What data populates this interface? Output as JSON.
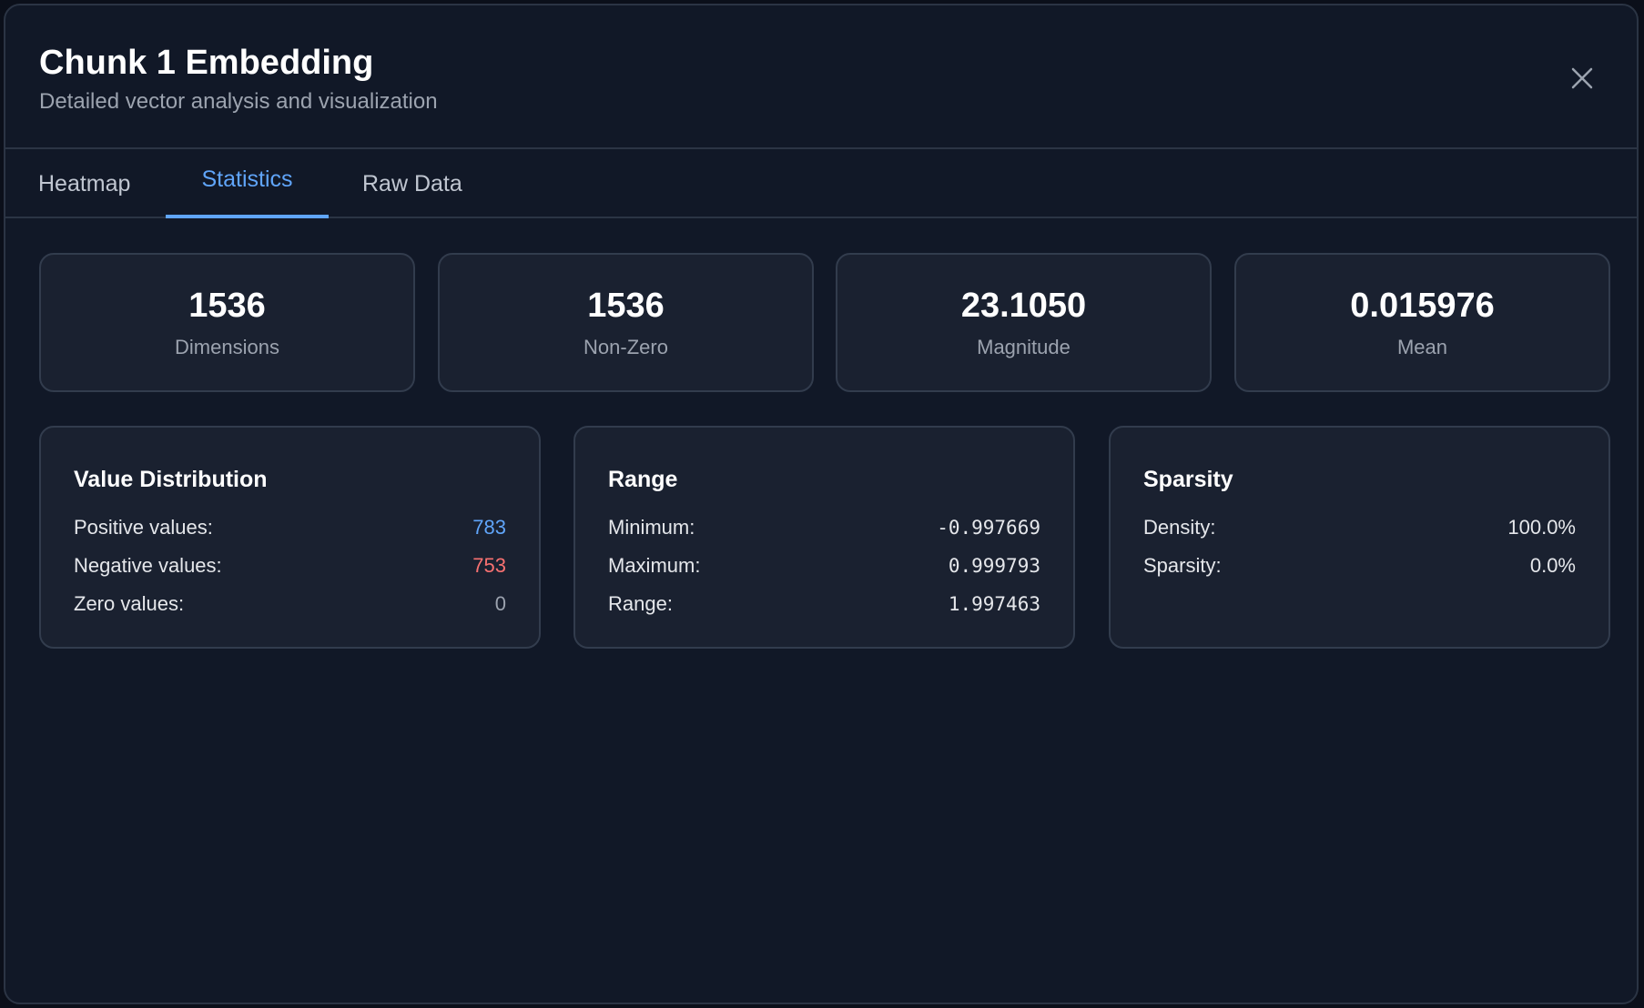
{
  "header": {
    "title": "Chunk 1 Embedding",
    "subtitle": "Detailed vector analysis and visualization",
    "close_icon": "close-icon"
  },
  "tabs": [
    {
      "label": "Heatmap",
      "active": false
    },
    {
      "label": "Statistics",
      "active": true
    },
    {
      "label": "Raw Data",
      "active": false
    }
  ],
  "stats": [
    {
      "value": "1536",
      "label": "Dimensions"
    },
    {
      "value": "1536",
      "label": "Non-Zero"
    },
    {
      "value": "23.1050",
      "label": "Magnitude"
    },
    {
      "value": "0.015976",
      "label": "Mean"
    }
  ],
  "distribution": {
    "title": "Value Distribution",
    "rows": [
      {
        "label": "Positive values:",
        "value": "783"
      },
      {
        "label": "Negative values:",
        "value": "753"
      },
      {
        "label": "Zero values:",
        "value": "0"
      }
    ]
  },
  "range": {
    "title": "Range",
    "rows": [
      {
        "label": "Minimum:",
        "value": "-0.997669"
      },
      {
        "label": "Maximum:",
        "value": "0.999793"
      },
      {
        "label": "Range:",
        "value": "1.997463"
      }
    ]
  },
  "sparsity": {
    "title": "Sparsity",
    "rows": [
      {
        "label": "Density:",
        "value": "100.0%"
      },
      {
        "label": "Sparsity:",
        "value": "0.0%"
      }
    ]
  },
  "colors": {
    "accent": "#60a5fa",
    "positive": "#60a5fa",
    "negative": "#f87171",
    "background": "#111827",
    "card": "#1a2130"
  }
}
